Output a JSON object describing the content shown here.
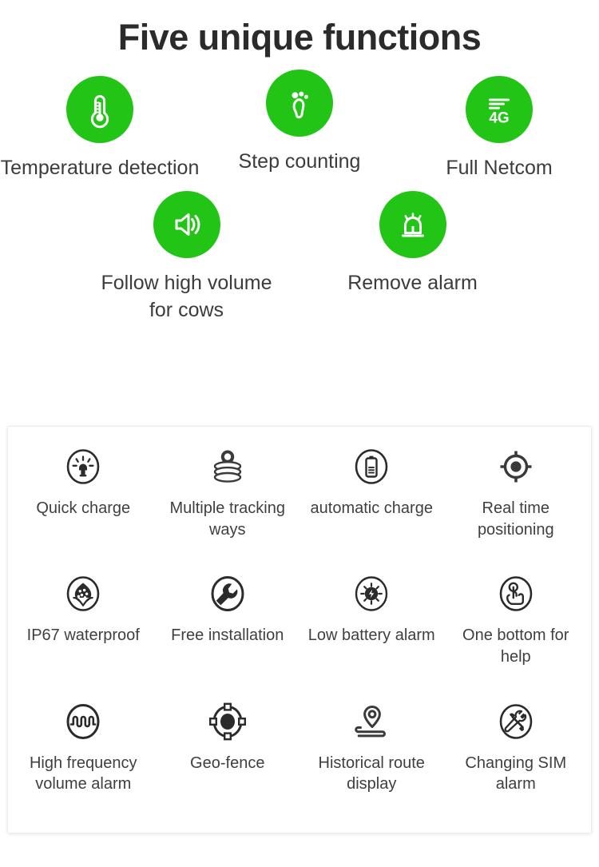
{
  "colors": {
    "green": "#22c516",
    "icon_dark": "#2b2b2b",
    "text": "#3c3c3c",
    "title": "#2b2b2b",
    "card_bg": "#ffffff",
    "page_bg": "#ffffff"
  },
  "header": {
    "title": "Five unique functions"
  },
  "top_features": {
    "row1": [
      {
        "label": "Temperature detection",
        "icon": "thermometer-icon"
      },
      {
        "label": "Step counting",
        "icon": "footprint-icon"
      },
      {
        "label": "Full Netcom",
        "icon": "4g-signal-icon"
      }
    ],
    "row2": [
      {
        "label": "Follow high volume for cows",
        "icon": "speaker-volume-icon"
      },
      {
        "label": "Remove alarm",
        "icon": "siren-alarm-icon"
      }
    ]
  },
  "feature_card": {
    "items": [
      {
        "label": "Quick charge",
        "icon": "plug-rays-icon"
      },
      {
        "label": "Multiple tracking ways",
        "icon": "pin-layers-icon"
      },
      {
        "label": "automatic charge",
        "icon": "battery-icon"
      },
      {
        "label": "Real time positioning",
        "icon": "crosshair-target-icon"
      },
      {
        "label": "IP67 waterproof",
        "icon": "water-droplet-icon"
      },
      {
        "label": "Free installation",
        "icon": "wrench-icon"
      },
      {
        "label": "Low battery alarm",
        "icon": "lightning-rays-icon"
      },
      {
        "label": "One bottom for help",
        "icon": "hand-press-icon"
      },
      {
        "label": "High frequency volume alarm",
        "icon": "waveform-icon"
      },
      {
        "label": "Geo-fence",
        "icon": "geofence-nodes-icon"
      },
      {
        "label": "Historical route display",
        "icon": "route-pin-icon"
      },
      {
        "label": "Changing SIM alarm",
        "icon": "tools-cross-icon"
      }
    ]
  }
}
